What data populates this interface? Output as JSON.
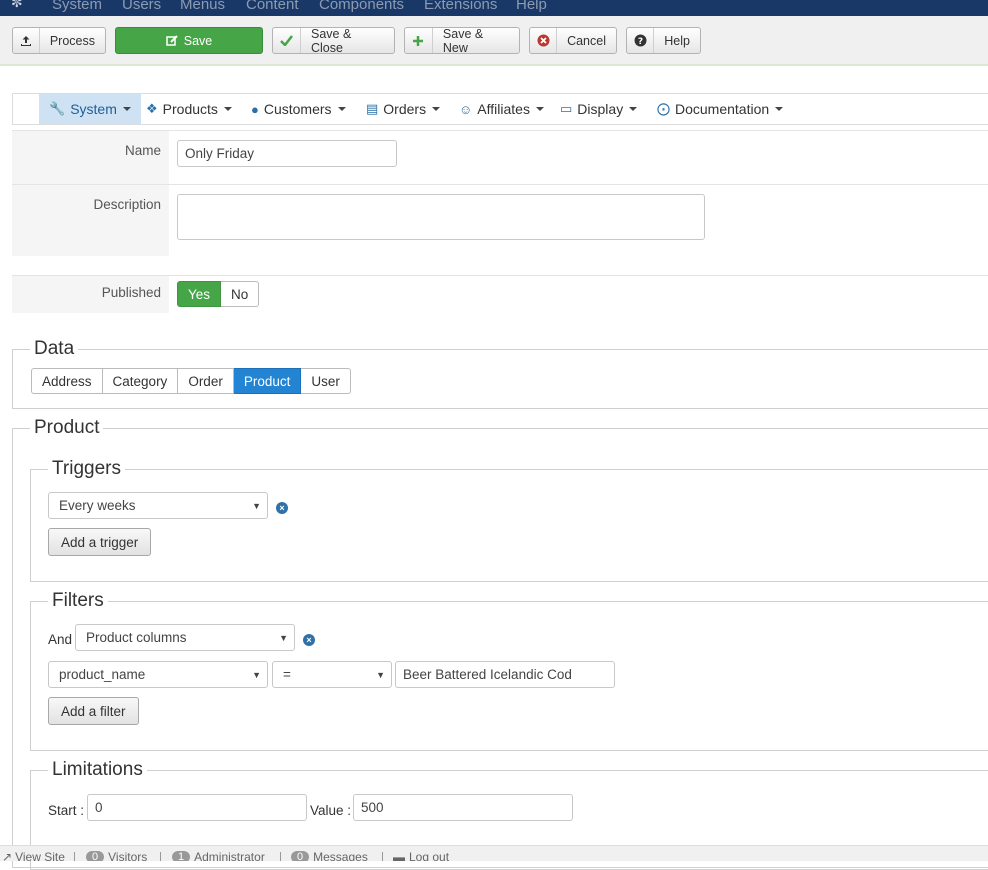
{
  "topbar": {
    "menu": [
      "System",
      "Users",
      "Menus",
      "Content",
      "Components",
      "Extensions",
      "Help"
    ]
  },
  "toolbar": {
    "process": "Process",
    "save": "Save",
    "save_close": "Save & Close",
    "save_new": "Save & New",
    "cancel": "Cancel",
    "help": "Help"
  },
  "submenu": {
    "items": [
      {
        "label": "System",
        "icon": "wrench-icon"
      },
      {
        "label": "Products",
        "icon": "cubes-icon"
      },
      {
        "label": "Customers",
        "icon": "user-icon"
      },
      {
        "label": "Orders",
        "icon": "card-icon"
      },
      {
        "label": "Affiliates",
        "icon": "users-icon"
      },
      {
        "label": "Display",
        "icon": "monitor-icon"
      },
      {
        "label": "Documentation",
        "icon": "lifebuoy-icon"
      }
    ]
  },
  "form": {
    "name_label": "Name",
    "name_value": "Only Friday",
    "description_label": "Description",
    "description_value": "",
    "published_label": "Published",
    "published_yes": "Yes",
    "published_no": "No"
  },
  "data_section": {
    "legend": "Data",
    "tabs": [
      "Address",
      "Category",
      "Order",
      "Product",
      "User"
    ],
    "active_tab": "Product"
  },
  "product_section": {
    "legend": "Product",
    "triggers": {
      "legend": "Triggers",
      "selected": "Every weeks",
      "add_button": "Add a trigger"
    },
    "filters": {
      "legend": "Filters",
      "and_label": "And",
      "type_selected": "Product columns",
      "column_selected": "product_name",
      "operator_selected": "=",
      "value": "Beer Battered Icelandic Cod",
      "add_button": "Add a filter"
    },
    "limitations": {
      "legend": "Limitations",
      "start_label": "Start :",
      "start_value": "0",
      "value_label": "Value :",
      "value_value": "500"
    }
  },
  "statusbar": {
    "view_site": "View Site",
    "visitors_count": "0",
    "visitors": "Visitors",
    "admin_count": "1",
    "administrator": "Administrator",
    "messages_count": "0",
    "messages": "Messages",
    "logout": "Log out"
  },
  "colors": {
    "topbar": "#1a3867",
    "save_green": "#46a546",
    "active_blue": "#2384d3",
    "submenu_active": "#cfe2f3"
  }
}
